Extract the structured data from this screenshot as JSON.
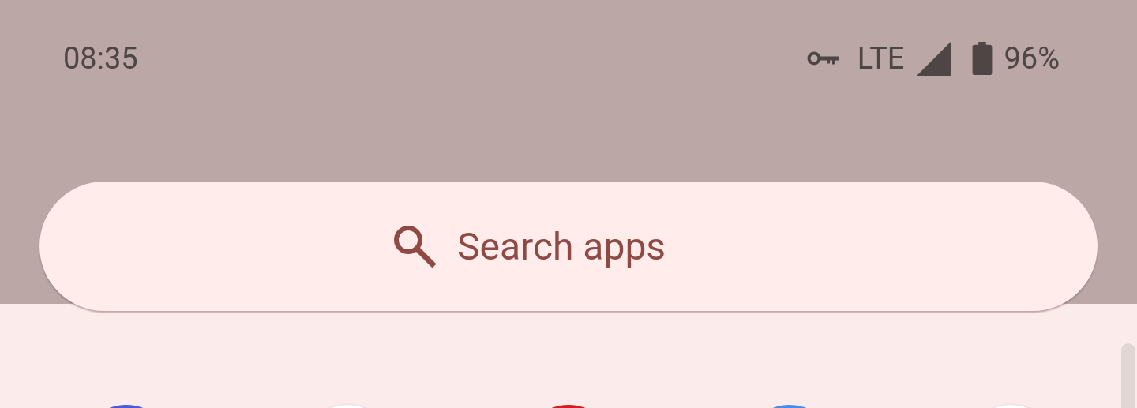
{
  "status_bar": {
    "time": "08:35",
    "network": "LTE",
    "battery": "96%"
  },
  "search": {
    "placeholder": "Search apps"
  }
}
